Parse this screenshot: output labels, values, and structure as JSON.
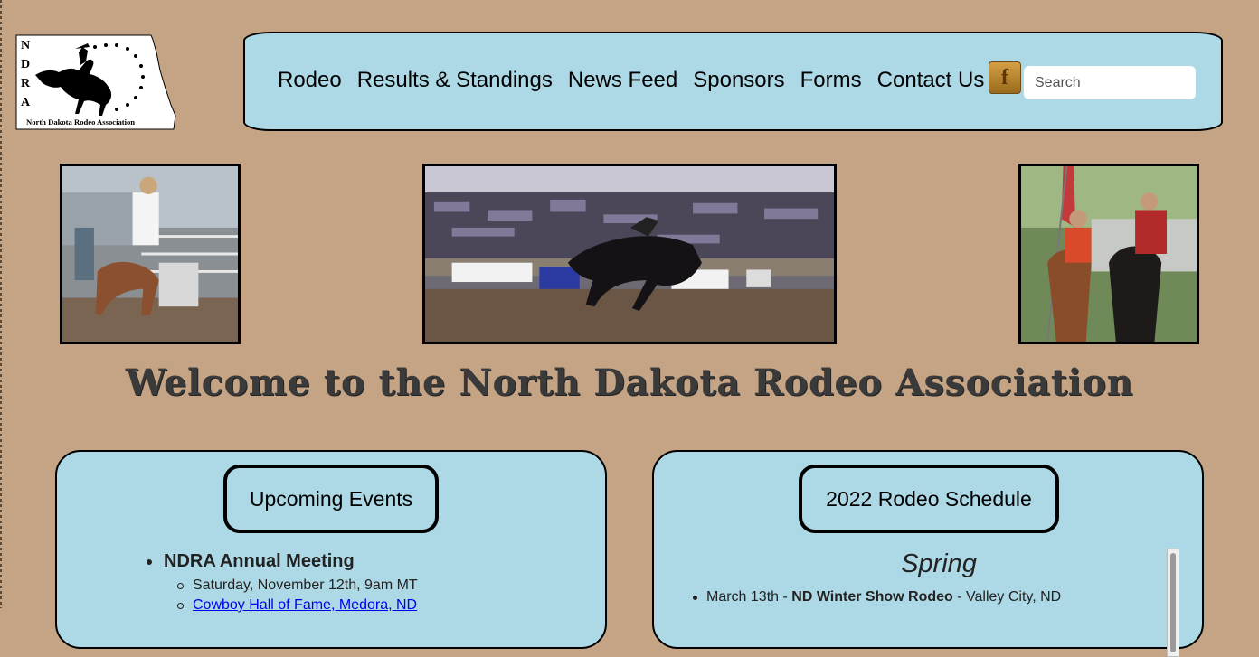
{
  "logo": {
    "letters": [
      "N",
      "D",
      "R",
      "A"
    ],
    "caption": "North Dakota Rodeo Association"
  },
  "nav": {
    "items": [
      "Rodeo",
      "Results & Standings",
      "News Feed",
      "Sponsors",
      "Forms",
      "Contact Us"
    ],
    "facebook_icon": "facebook-icon",
    "facebook_glyph": "f",
    "search_placeholder": "Search"
  },
  "welcome": "Welcome to the North Dakota Rodeo Association",
  "events": {
    "title": "Upcoming Events",
    "items": [
      {
        "name": "NDRA Annual Meeting",
        "details": [
          "Saturday, November 12th, 9am MT"
        ],
        "link": "Cowboy Hall of Fame, Medora, ND"
      }
    ]
  },
  "schedule": {
    "title": "2022 Rodeo Schedule",
    "season": "Spring",
    "items": [
      {
        "date": "March 13th - ",
        "name": "ND Winter Show Rodeo",
        "location": " - Valley City, ND"
      }
    ]
  },
  "colors": {
    "background": "#c4a484",
    "panel": "#add8e6",
    "link": "#0000ee"
  }
}
